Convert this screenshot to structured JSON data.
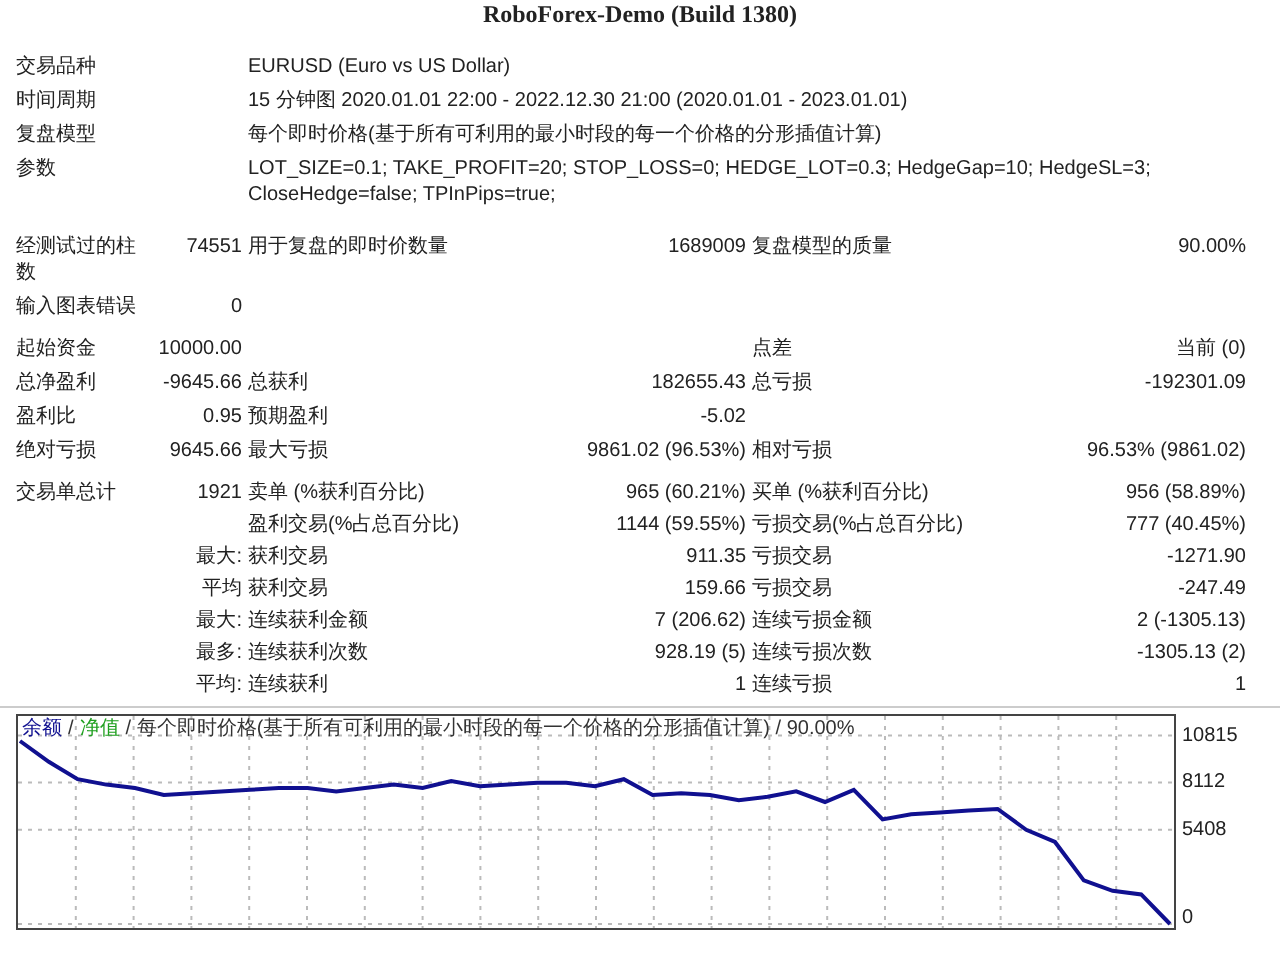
{
  "title": "RoboForex-Demo (Build 1380)",
  "info": [
    {
      "label": "交易品种",
      "value": "EURUSD (Euro vs US Dollar)"
    },
    {
      "label": "时间周期",
      "value": "15 分钟图 2020.01.01 22:00 - 2022.12.30 21:00 (2020.01.01 - 2023.01.01)"
    },
    {
      "label": "复盘模型",
      "value": "每个即时价格(基于所有可利用的最小时段的每一个价格的分形插值计算)"
    },
    {
      "label": "参数",
      "value": "LOT_SIZE=0.1; TAKE_PROFIT=20; STOP_LOSS=0; HEDGE_LOT=0.3; HedgeGap=10; HedgeSL=3; CloseHedge=false; TPInPips=true;"
    }
  ],
  "stat_groups": [
    [
      {
        "label": "经测试过的柱数",
        "value": "74551",
        "label_2": "用于复盘的即时价数量",
        "value_2": "1689009",
        "label_3": "复盘模型的质量",
        "value_3": "90.00%"
      },
      {
        "label": "输入图表错误",
        "value": "0"
      }
    ],
    [
      {
        "label": "起始资金",
        "value": "10000.00",
        "label_3": "点差",
        "value_3": "当前 (0)"
      },
      {
        "label": "总净盈利",
        "value": "-9645.66",
        "label_2": "总获利",
        "value_2": "182655.43",
        "label_3": "总亏损",
        "value_3": "-192301.09"
      },
      {
        "label": "盈利比",
        "value": "0.95",
        "label_2": "预期盈利",
        "value_2": "-5.02"
      },
      {
        "label": "绝对亏损",
        "value": "9645.66",
        "label_2": "最大亏损",
        "value_2": "9861.02 (96.53%)",
        "label_3": "相对亏损",
        "value_3": "96.53% (9861.02)"
      }
    ],
    [
      {
        "label": "交易单总计",
        "value": "1921",
        "label_2": "卖单 (%获利百分比)",
        "value_2": "965 (60.21%)",
        "label_3": "买单 (%获利百分比)",
        "value_3": "956 (58.89%)"
      },
      {
        "label_2": "盈利交易(%占总百分比)",
        "value_2": "1144 (59.55%)",
        "label_3": "亏损交易(%占总百分比)",
        "value_3": "777 (40.45%)"
      },
      {
        "value": "最大:",
        "label_2": "获利交易",
        "value_2": "911.35",
        "label_3": "亏损交易",
        "value_3": "-1271.90"
      },
      {
        "value": "平均",
        "label_2": "获利交易",
        "value_2": "159.66",
        "label_3": "亏损交易",
        "value_3": "-247.49"
      },
      {
        "value": "最大:",
        "label_2": "连续获利金额",
        "value_2": "7 (206.62)",
        "label_3": "连续亏损金额",
        "value_3": "2 (-1305.13)"
      },
      {
        "value": "最多:",
        "label_2": "连续获利次数",
        "value_2": "928.19 (5)",
        "label_3": "连续亏损次数",
        "value_3": "-1305.13 (2)"
      },
      {
        "value": "平均:",
        "label_2": "连续获利",
        "value_2": "1",
        "label_3": "连续亏损",
        "value_3": "1"
      }
    ]
  ],
  "chart": {
    "legend": [
      {
        "text": "/",
        "color": "#333333"
      },
      {
        "text": "净值",
        "color": "#20a020"
      },
      {
        "text": "/ 每个即时价格(基于所有可利用的最小时段的每一个价格的分形插值计算) / 90.00%",
        "color": "#333333"
      }
    ],
    "chart_data": {
      "type": "line",
      "grid": true,
      "ylim": [
        0,
        11700
      ],
      "yticks": [
        0,
        5408,
        8112,
        10815
      ],
      "series": [
        {
          "name": "余额",
          "color": "#101090",
          "values": [
            10500,
            9300,
            8300,
            8000,
            7800,
            7400,
            7500,
            7600,
            7700,
            7800,
            7800,
            7600,
            7800,
            8000,
            7800,
            8200,
            7900,
            8000,
            8100,
            8100,
            7900,
            8300,
            7400,
            7500,
            7400,
            7100,
            7300,
            7600,
            7000,
            7700,
            6000,
            6300,
            6400,
            6500,
            6600,
            5400,
            4700,
            2500,
            1900,
            1700,
            0
          ]
        }
      ]
    }
  }
}
